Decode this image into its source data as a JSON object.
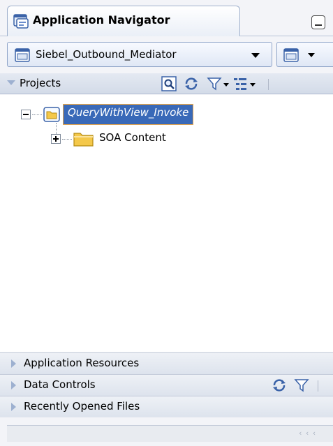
{
  "navigator": {
    "title": "Application Navigator",
    "application": "Siebel_Outbound_Mediator"
  },
  "projects": {
    "header": "Projects",
    "tree": [
      {
        "label": "QueryWithView_Invoke",
        "expanded": true,
        "selected": true,
        "children": [
          {
            "label": "SOA Content",
            "expanded": false
          }
        ]
      }
    ]
  },
  "panels": {
    "application_resources": "Application Resources",
    "data_controls": "Data Controls",
    "recently_opened_files": "Recently Opened Files"
  },
  "status": {
    "grip": "‹ ‹ ‹"
  },
  "colors": {
    "selection": "#3969b8",
    "selection_border": "#e8a64a",
    "folder": "#f4c84a",
    "header_gradient": "#d3dbe8"
  }
}
